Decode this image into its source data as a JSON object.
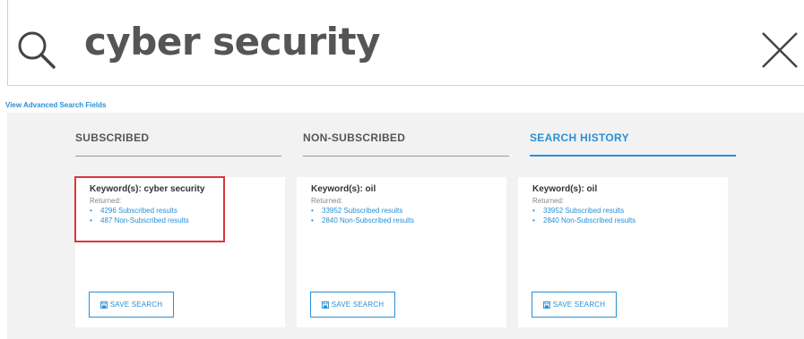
{
  "search": {
    "query": "cyber security",
    "advanced_link": "View Advanced Search Fields"
  },
  "tabs": [
    {
      "label": "SUBSCRIBED",
      "active": false
    },
    {
      "label": "NON-SUBSCRIBED",
      "active": false
    },
    {
      "label": "SEARCH HISTORY",
      "active": true
    }
  ],
  "cards": [
    {
      "title": "Keyword(s): cyber security",
      "returned_label": "Returned:",
      "subscribed": "4296 Subscribed results",
      "non_subscribed": "487 Non-Subscribed results",
      "button": "SAVE SEARCH",
      "highlighted": true
    },
    {
      "title": "Keyword(s): oil",
      "returned_label": "Returned:",
      "subscribed": "33952 Subscribed results",
      "non_subscribed": "2840 Non-Subscribed results",
      "button": "SAVE SEARCH",
      "highlighted": false
    },
    {
      "title": "Keyword(s): oil",
      "returned_label": "Returned:",
      "subscribed": "33952 Subscribed results",
      "non_subscribed": "2840 Non-Subscribed results",
      "button": "SAVE SEARCH",
      "highlighted": false
    }
  ],
  "icons": {
    "search": "search-icon",
    "close": "close-icon",
    "save": "floppy-disk-icon"
  },
  "colors": {
    "accent": "#2a8fd6",
    "highlight": "#d9363e",
    "panel_bg": "#f2f2f2",
    "query_text": "#555555"
  }
}
